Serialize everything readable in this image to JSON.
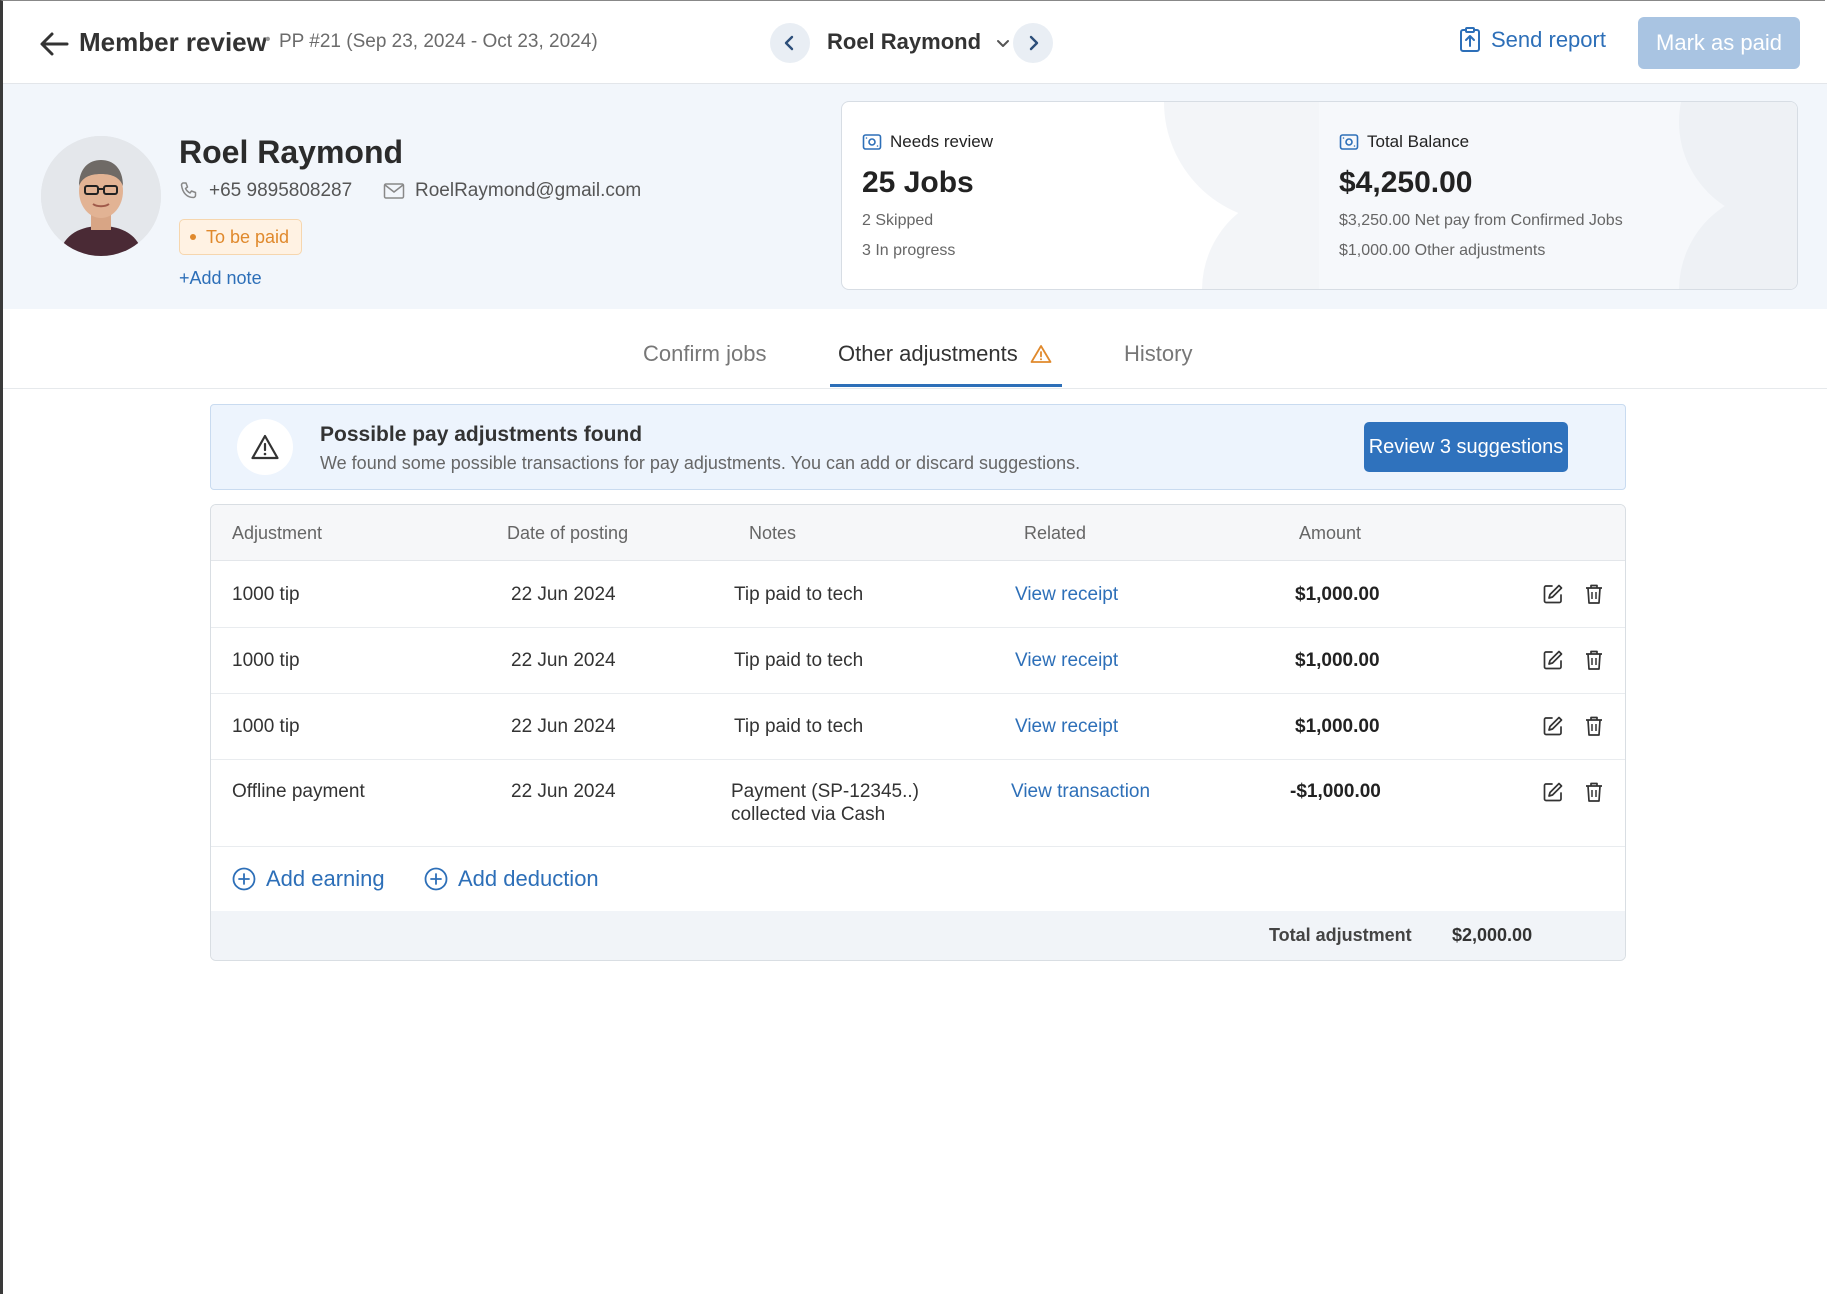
{
  "header": {
    "title": "Member review",
    "separator": "•",
    "period": "PP #21 (Sep 23, 2024 - Oct 23, 2024)",
    "member_name": "Roel Raymond",
    "send_report_label": "Send report",
    "mark_paid_label": "Mark as paid"
  },
  "profile": {
    "name": "Roel Raymond",
    "phone": "+65 9895808287",
    "email": "RoelRaymond@gmail.com",
    "status_badge": "To be paid",
    "add_note_label": "+Add note",
    "status_color": "#e0892c"
  },
  "cards": {
    "needs_review": {
      "label": "Needs review",
      "value": "25 Jobs",
      "line1": "2 Skipped",
      "line2": "3 In progress"
    },
    "total_balance": {
      "label": "Total Balance",
      "value": "$4,250.00",
      "line1": "$3,250.00 Net pay from Confirmed Jobs",
      "line2": "$1,000.00 Other adjustments"
    }
  },
  "tabs": [
    {
      "label": "Confirm jobs"
    },
    {
      "label": "Other adjustments",
      "active": true,
      "icon": "warning-icon"
    },
    {
      "label": "History"
    }
  ],
  "alert": {
    "heading": "Possible pay adjustments found",
    "body": "We found some possible transactions for pay adjustments. You can add or discard suggestions.",
    "button_label": "Review 3 suggestions"
  },
  "table": {
    "columns": [
      "Adjustment",
      "Date of posting",
      "Notes",
      "Related",
      "Amount"
    ],
    "rows": [
      {
        "adjustment": "1000 tip",
        "date": "22 Jun 2024",
        "notes": "Tip paid to tech",
        "notes2": "",
        "related": "View receipt",
        "amount": "$1,000.00"
      },
      {
        "adjustment": "1000 tip",
        "date": "22 Jun 2024",
        "notes": "Tip paid to tech",
        "notes2": "",
        "related": "View receipt",
        "amount": "$1,000.00"
      },
      {
        "adjustment": "1000 tip",
        "date": "22 Jun 2024",
        "notes": "Tip paid to tech",
        "notes2": "",
        "related": "View receipt",
        "amount": "$1,000.00"
      },
      {
        "adjustment": "Offline payment",
        "date": "22 Jun 2024",
        "notes": "Payment (SP-12345..)",
        "notes2": "collected via Cash",
        "related": "View transaction",
        "amount": "-$1,000.00"
      }
    ],
    "add_earning_label": "Add earning",
    "add_deduction_label": "Add deduction",
    "total_label": "Total adjustment",
    "total_value": "$2,000.00"
  },
  "colors": {
    "accent": "#2d6fb8",
    "primary_button": "#2f72bd",
    "disabled_button": "#a9c4e2",
    "band_background": "#f2f6fb"
  }
}
